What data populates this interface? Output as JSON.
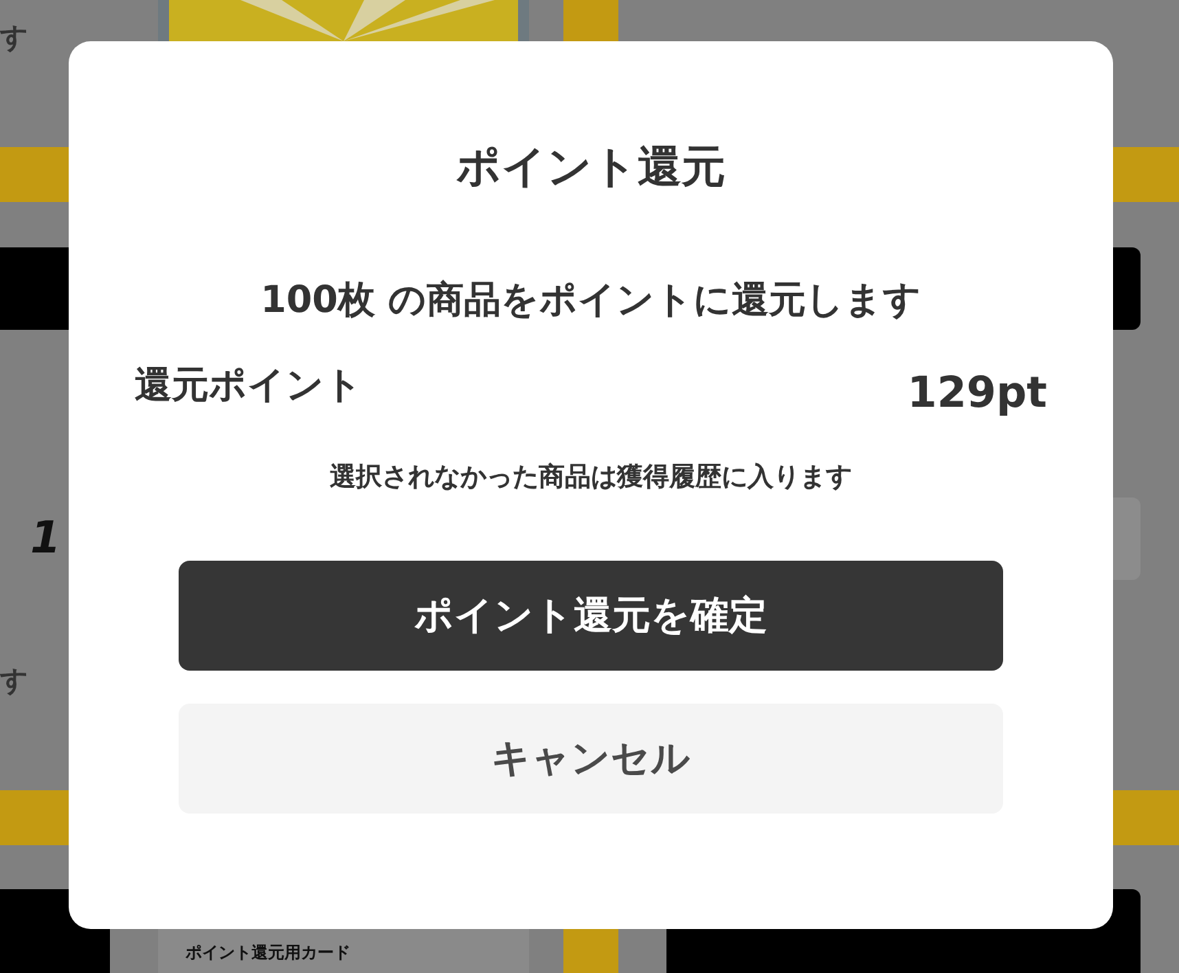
{
  "page": {
    "side_note_top": "す",
    "side_note_bottom": "す",
    "price_fragment": "1",
    "card_label": "ポイント還元用カード"
  },
  "dialog": {
    "title": "ポイント還元",
    "message": "100枚 の商品をポイントに還元します",
    "points_label": "還元ポイント",
    "points_value": "129pt",
    "note": "選択されなかった商品は獲得履歴に入ります",
    "buttons": [
      {
        "label": "ポイント還元を確定",
        "kind": "primary"
      },
      {
        "label": "キャンセル",
        "kind": "secondary"
      }
    ]
  }
}
